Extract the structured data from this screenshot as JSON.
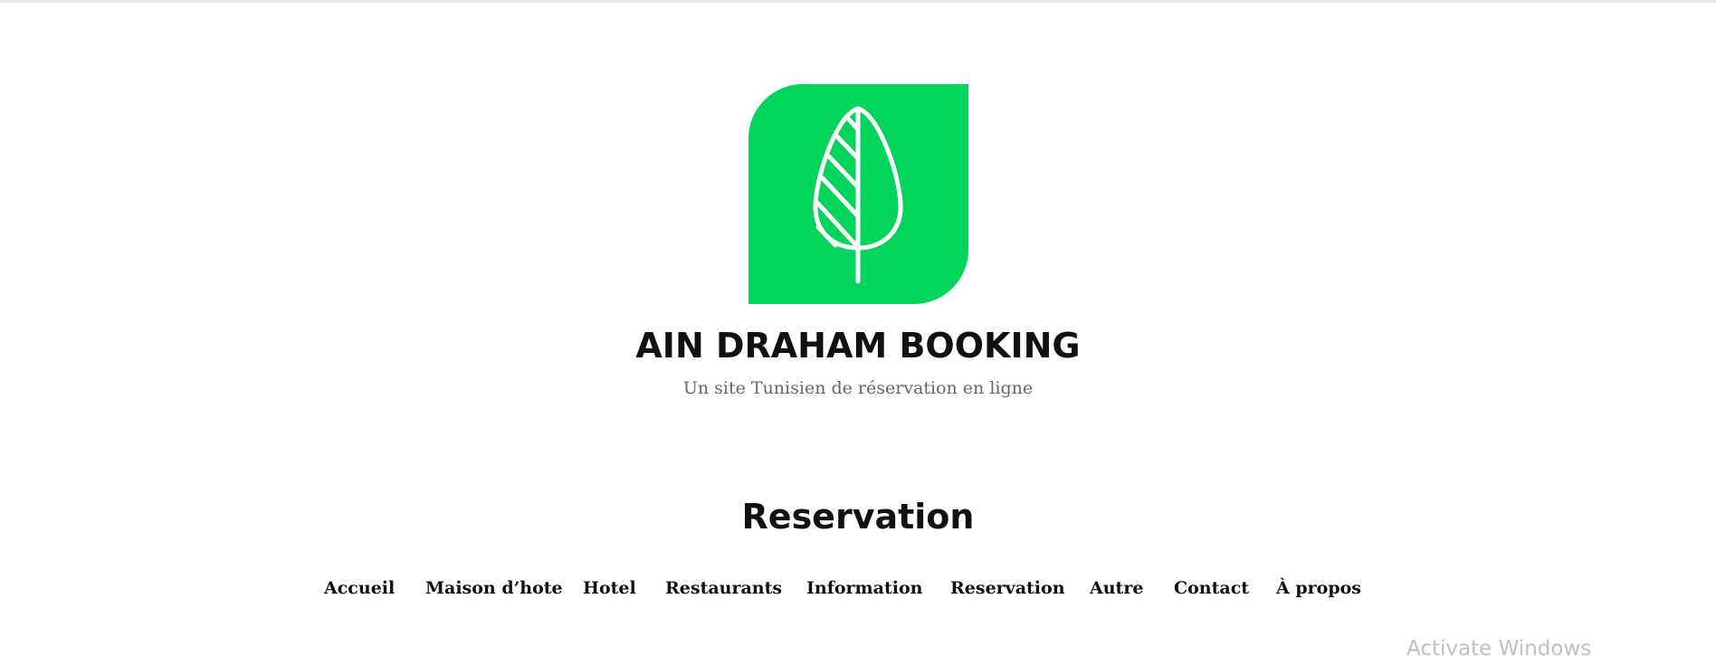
{
  "site": {
    "title": "AIN DRAHAM BOOKING",
    "tagline": "Un site Tunisien de réservation en ligne",
    "logo_icon": "tree-leaf-icon",
    "brand_color": "#00d45a"
  },
  "page": {
    "title": "Reservation"
  },
  "nav": {
    "items": [
      {
        "label": "Accueil"
      },
      {
        "label": "Maison d’hote"
      },
      {
        "label": "Hotel"
      },
      {
        "label": "Restaurants"
      },
      {
        "label": "Information"
      },
      {
        "label": "Reservation"
      },
      {
        "label": "Autre"
      },
      {
        "label": "Contact"
      },
      {
        "label": "À propos"
      }
    ]
  },
  "overlay": {
    "watermark": "Activate Windows"
  }
}
